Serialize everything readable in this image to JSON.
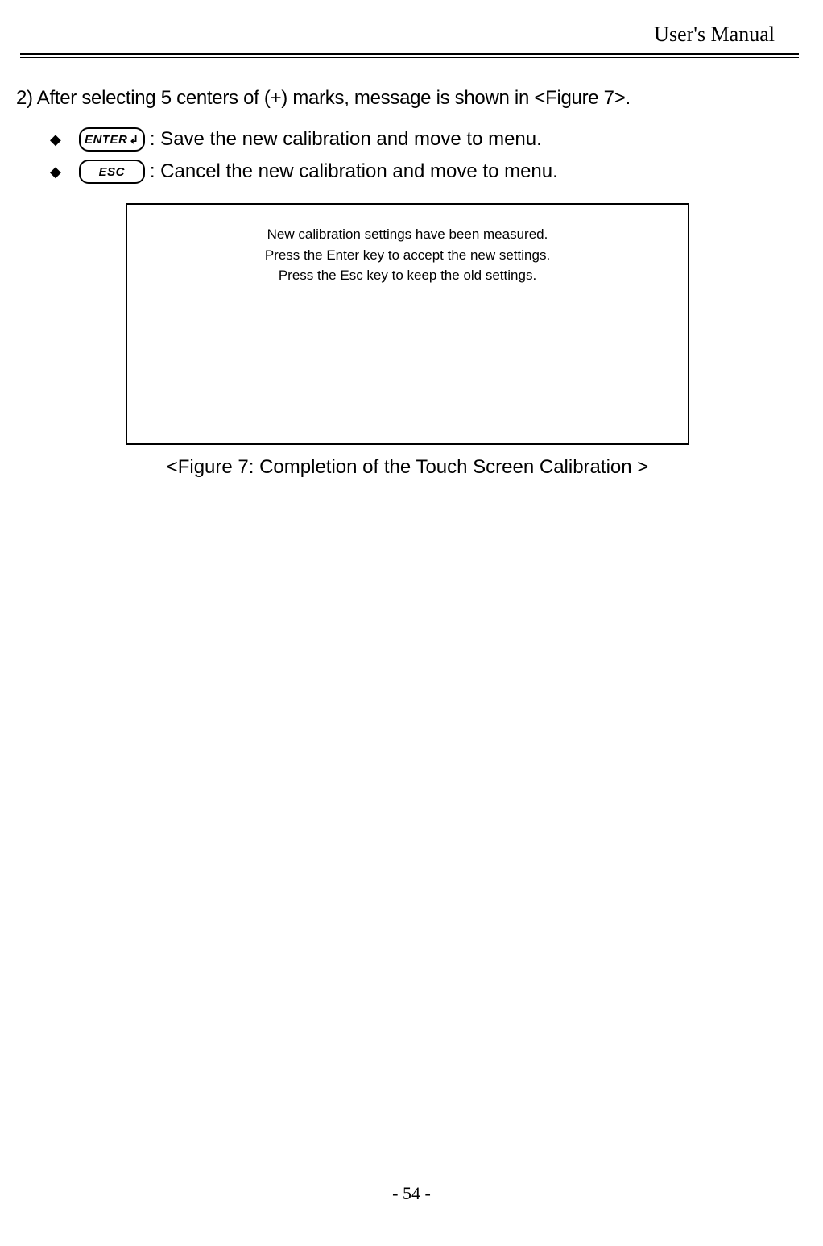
{
  "header": {
    "title": "User's Manual"
  },
  "step": {
    "text": "2) After selecting 5 centers of (+) marks, message is shown in <Figure 7>."
  },
  "bullets": [
    {
      "key_label": "ENTER",
      "has_arrow": true,
      "desc": " : Save the new calibration and move to menu."
    },
    {
      "key_label": "ESC",
      "has_arrow": false,
      "desc": ": Cancel the new calibration and move to menu."
    }
  ],
  "figure": {
    "line1": "New calibration settings have been measured.",
    "line2": "Press the Enter key to accept the new settings.",
    "line3": "Press the Esc key to keep the old settings.",
    "caption": "<Figure 7: Completion of the Touch Screen Calibration >"
  },
  "footer": {
    "page": "- 54 -"
  }
}
